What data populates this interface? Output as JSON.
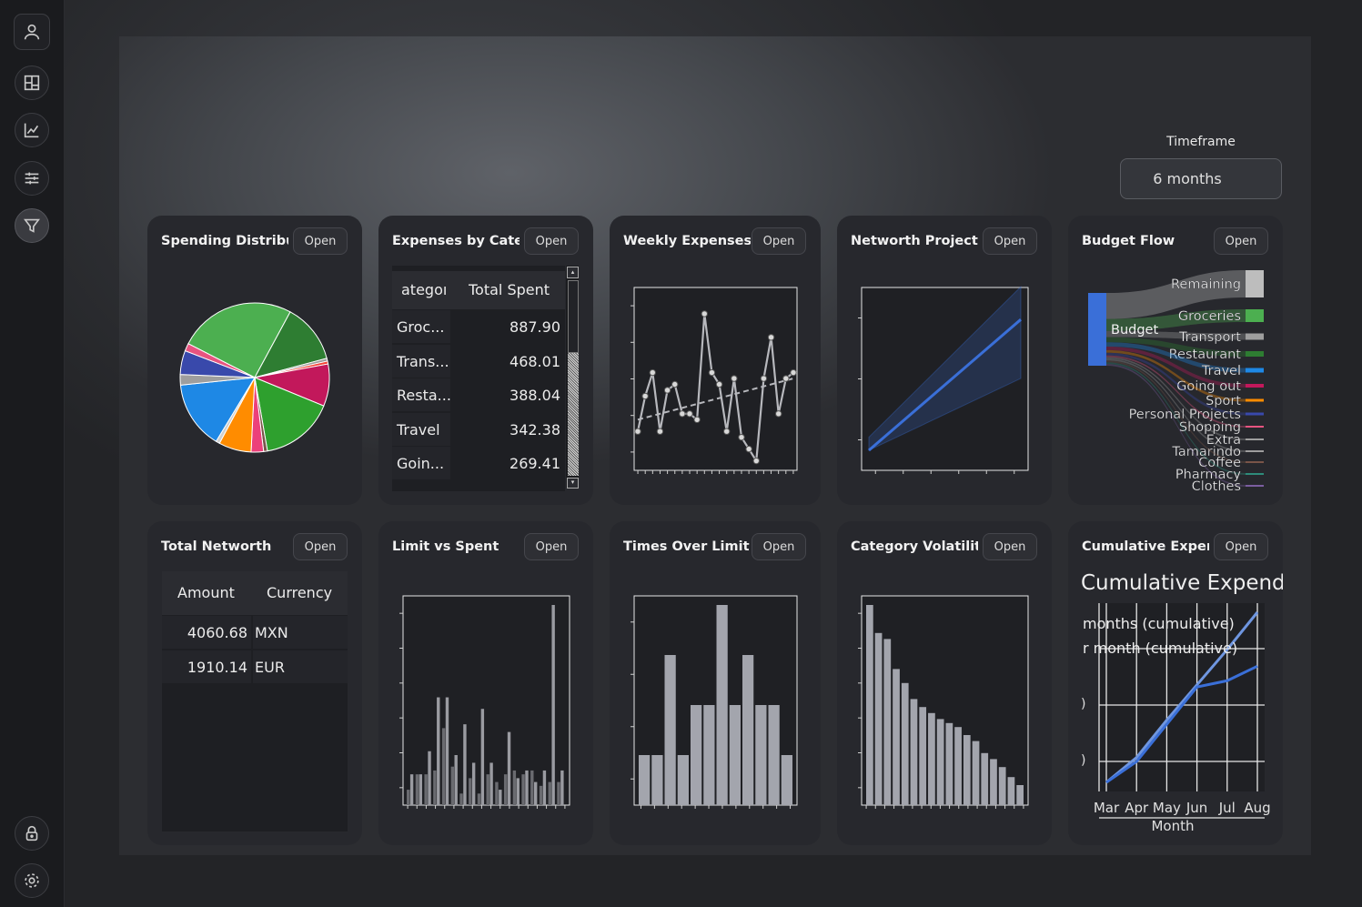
{
  "sidebar": {
    "items": [
      {
        "icon": "user-icon"
      },
      {
        "icon": "dashboard-icon"
      },
      {
        "icon": "chart-icon"
      },
      {
        "icon": "sliders-icon"
      },
      {
        "icon": "filter-icon"
      }
    ],
    "bottom": [
      {
        "icon": "lock-icon"
      },
      {
        "icon": "settings-icon"
      }
    ]
  },
  "timeframe": {
    "label": "Timeframe",
    "value": "6 months"
  },
  "cards": {
    "spending": {
      "title": "Spending Distribution",
      "open": "Open"
    },
    "expenses": {
      "title": "Expenses by Category",
      "open": "Open"
    },
    "weekly": {
      "title": "Weekly Expenses",
      "open": "Open"
    },
    "networth_proj": {
      "title": "Networth Projection",
      "open": "Open"
    },
    "budget_flow": {
      "title": "Budget Flow",
      "open": "Open"
    },
    "total_networth": {
      "title": "Total Networth",
      "open": "Open"
    },
    "limit_spent": {
      "title": "Limit vs Spent",
      "open": "Open"
    },
    "times_over": {
      "title": "Times Over Limit",
      "open": "Open"
    },
    "volatility": {
      "title": "Category Volatility",
      "open": "Open"
    },
    "cumulative": {
      "title": "Cumulative Expenditure",
      "open": "Open"
    }
  },
  "expenses_table": {
    "headers": [
      "ategoı",
      "Total Spent"
    ],
    "rows": [
      [
        "Groc...",
        "887.90"
      ],
      [
        "Trans...",
        "468.01"
      ],
      [
        "Resta...",
        "388.04"
      ],
      [
        "Travel",
        "342.38"
      ],
      [
        "Goin...",
        "269.41"
      ]
    ]
  },
  "networth_table": {
    "headers": [
      "Amount",
      "Currency"
    ],
    "rows": [
      [
        "4060.68",
        "MXN"
      ],
      [
        "1910.14",
        "EUR"
      ]
    ]
  },
  "colors": {
    "accent_blue": "#3a6fd8",
    "line_gray": "#b7b8bd",
    "bar_gray": "#a3a5ad"
  },
  "chart_data": [
    {
      "type": "pie",
      "id": "spending",
      "slices": [
        {
          "value": 24.5,
          "color": "#4caf50"
        },
        {
          "value": 12.5,
          "color": "#2e7d32"
        },
        {
          "value": 0.6,
          "color": "#9e9e9e"
        },
        {
          "value": 0.6,
          "color": "#f44336"
        },
        {
          "value": 8.8,
          "color": "#c2185b"
        },
        {
          "value": 15.5,
          "color": "#2ea02e"
        },
        {
          "value": 0.8,
          "color": "#795548"
        },
        {
          "value": 2.6,
          "color": "#ec407a"
        },
        {
          "value": 6.8,
          "color": "#ff8c00"
        },
        {
          "value": 0.8,
          "color": "#cfcfcf"
        },
        {
          "value": 14.2,
          "color": "#1e88e5"
        },
        {
          "value": 2.2,
          "color": "#9e9e9e"
        },
        {
          "value": 5.0,
          "color": "#3949ab"
        },
        {
          "value": 1.6,
          "color": "#e75480"
        }
      ]
    },
    {
      "type": "line",
      "id": "weekly",
      "values": [
        6,
        12,
        16,
        6,
        13,
        14,
        9,
        9,
        8,
        26,
        16,
        14,
        6,
        15,
        5,
        3,
        1,
        15,
        22,
        9,
        15,
        16
      ],
      "trend": [
        8,
        15
      ],
      "ylim": [
        0,
        28
      ]
    },
    {
      "type": "line",
      "id": "networth_projection",
      "x": [
        0,
        1
      ],
      "y": [
        0,
        1
      ],
      "band_low": [
        0.0,
        0.55
      ],
      "band_high": [
        0.1,
        1.25
      ]
    },
    {
      "type": "sankey",
      "id": "budget_flow",
      "source": "Budget",
      "targets": [
        {
          "label": "Remaining",
          "color": "#bdbdbd"
        },
        {
          "label": "Groceries",
          "color": "#4caf50"
        },
        {
          "label": "Transport",
          "color": "#9e9e9e"
        },
        {
          "label": "Restaurant",
          "color": "#2e7d32"
        },
        {
          "label": "Travel",
          "color": "#1e88e5"
        },
        {
          "label": "Going out",
          "color": "#c2185b"
        },
        {
          "label": "Sport",
          "color": "#ff8c00"
        },
        {
          "label": "Personal Projects",
          "color": "#3949ab"
        },
        {
          "label": "Shopping",
          "color": "#e75480"
        },
        {
          "label": "Extra",
          "color": "#9e9e9e"
        },
        {
          "label": "Tamarindo",
          "color": "#9e9e9e"
        },
        {
          "label": "Coffee",
          "color": "#795548"
        },
        {
          "label": "Pharmacy",
          "color": "#2e8b7a"
        },
        {
          "label": "Clothes",
          "color": "#7b5ea0"
        }
      ]
    },
    {
      "type": "bar",
      "id": "limit_vs_spent",
      "series": [
        {
          "values": [
            4,
            8,
            8,
            9,
            20,
            10,
            3,
            7,
            3,
            8,
            6,
            8,
            9,
            8,
            9,
            5,
            6,
            6
          ]
        },
        {
          "values": [
            8,
            8,
            14,
            28,
            28,
            13,
            21,
            11,
            25,
            11,
            4,
            19,
            7,
            9,
            6,
            9,
            52,
            9
          ]
        }
      ],
      "ylim": [
        0,
        52
      ]
    },
    {
      "type": "bar",
      "id": "times_over_limit",
      "values": [
        1,
        1,
        3,
        1,
        2,
        2,
        4,
        2,
        3,
        2,
        2,
        1
      ],
      "ylim": [
        0,
        4
      ]
    },
    {
      "type": "bar",
      "id": "category_volatility",
      "values": [
        100,
        86,
        83,
        68,
        61,
        53,
        49,
        46,
        43,
        41,
        39,
        35,
        32,
        26,
        23,
        19,
        14,
        10
      ],
      "ylim": [
        0,
        100
      ]
    },
    {
      "type": "line",
      "id": "cumulative_expenditure",
      "title": "Cumulative Expenditure — La",
      "legend": [
        "months (cumulative)",
        "r month (cumulative)"
      ],
      "categories": [
        "Mar",
        "Apr",
        "May",
        "Jun",
        "Jul",
        "Aug"
      ],
      "xlabel": "Month",
      "series": [
        {
          "values": [
            0,
            1.2,
            3.0,
            4.7,
            6.4,
            8.2
          ],
          "color": "#6f96e0"
        },
        {
          "values": [
            0,
            1.0,
            2.8,
            4.6,
            4.9,
            5.6
          ],
          "color": "#3a6fd8"
        }
      ]
    }
  ]
}
